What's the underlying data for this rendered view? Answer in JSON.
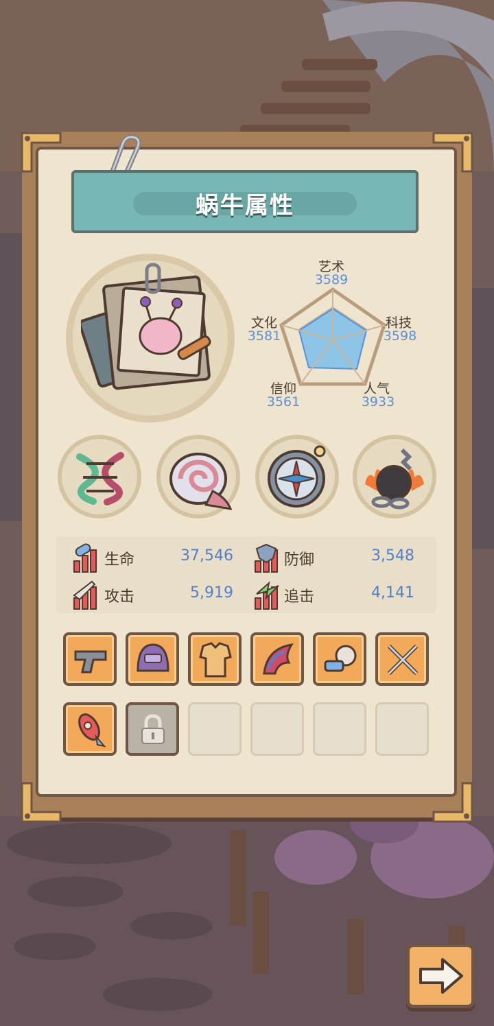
{
  "header": {
    "title": "蜗牛属性"
  },
  "attributes": [
    {
      "name": "艺术",
      "value": "3589"
    },
    {
      "name": "科技",
      "value": "3598"
    },
    {
      "name": "人气",
      "value": "3933"
    },
    {
      "name": "信仰",
      "value": "3561"
    },
    {
      "name": "文化",
      "value": "3581"
    }
  ],
  "equipment_circles": [
    "dna-icon",
    "shell-icon",
    "compass-icon",
    "chain-bomb-icon"
  ],
  "stats": [
    {
      "label": "生命",
      "value": "37,546",
      "icon": "health-icon"
    },
    {
      "label": "防御",
      "value": "3,548",
      "icon": "defense-icon"
    },
    {
      "label": "攻击",
      "value": "5,919",
      "icon": "attack-icon"
    },
    {
      "label": "追击",
      "value": "4,141",
      "icon": "pursuit-icon"
    }
  ],
  "slots_row1": [
    "pistol-icon",
    "helmet-icon",
    "armor-icon",
    "wing-icon",
    "watch-icon",
    "swords-icon"
  ],
  "slots_row2": [
    "rocket-icon",
    "lock-icon",
    "empty",
    "empty",
    "empty",
    "empty"
  ],
  "colors": {
    "accent": "#78b7b4",
    "value_blue": "#5a8fd8",
    "slot_orange": "#f2aa5a"
  }
}
